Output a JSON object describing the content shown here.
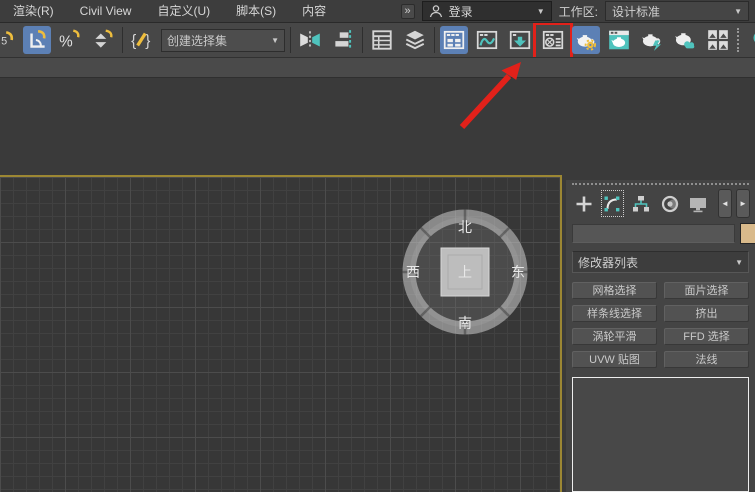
{
  "menubar": {
    "items": [
      "渲染(R)",
      "Civil View",
      "自定义(U)",
      "脚本(S)",
      "内容"
    ],
    "overflow_chevron": "»",
    "login_label": "登录",
    "workspace_label": "工作区:",
    "workspace_value": "设计标准"
  },
  "toolbar": {
    "selection_set_value": "创建选择集",
    "icons": [
      "snaps-toggle-2.5",
      "angle-snap-toggle",
      "percent-snap-toggle",
      "spinner-snap-toggle",
      "edit-named-selection-sets",
      "mirror",
      "align",
      "scene-explorer",
      "layer-explorer",
      "ribbon-toggle",
      "curve-editor",
      "schematic-view",
      "material-editor",
      "render-setup",
      "rendered-frame-window",
      "render-production",
      "render-in-cloud",
      "asset-library",
      "default-lighting-bulb"
    ],
    "highlighted_icon": "material-editor"
  },
  "viewport": {
    "compass": {
      "north": "北",
      "south": "南",
      "west": "西",
      "east": "东",
      "top": "上"
    }
  },
  "command_panel": {
    "tab_icons": [
      "create",
      "modify",
      "hierarchy",
      "motion",
      "display"
    ],
    "selected_tab": "modify",
    "scroll_left": "◄",
    "scroll_right": "►",
    "object_name_value": "",
    "modifier_list_label": "修改器列表",
    "modifier_buttons": [
      "网格选择",
      "面片选择",
      "样条线选择",
      "挤出",
      "涡轮平滑",
      "FFD 选择",
      "UVW 贴图",
      "法线"
    ]
  },
  "colors": {
    "accent_teal": "#4fc3bd",
    "accent_yellow": "#eebd3d",
    "active_blue": "#5c80b5",
    "annotation_red": "#e2211a",
    "viewport_border": "#9c8733",
    "object_color_swatch": "#d9ba8b"
  }
}
